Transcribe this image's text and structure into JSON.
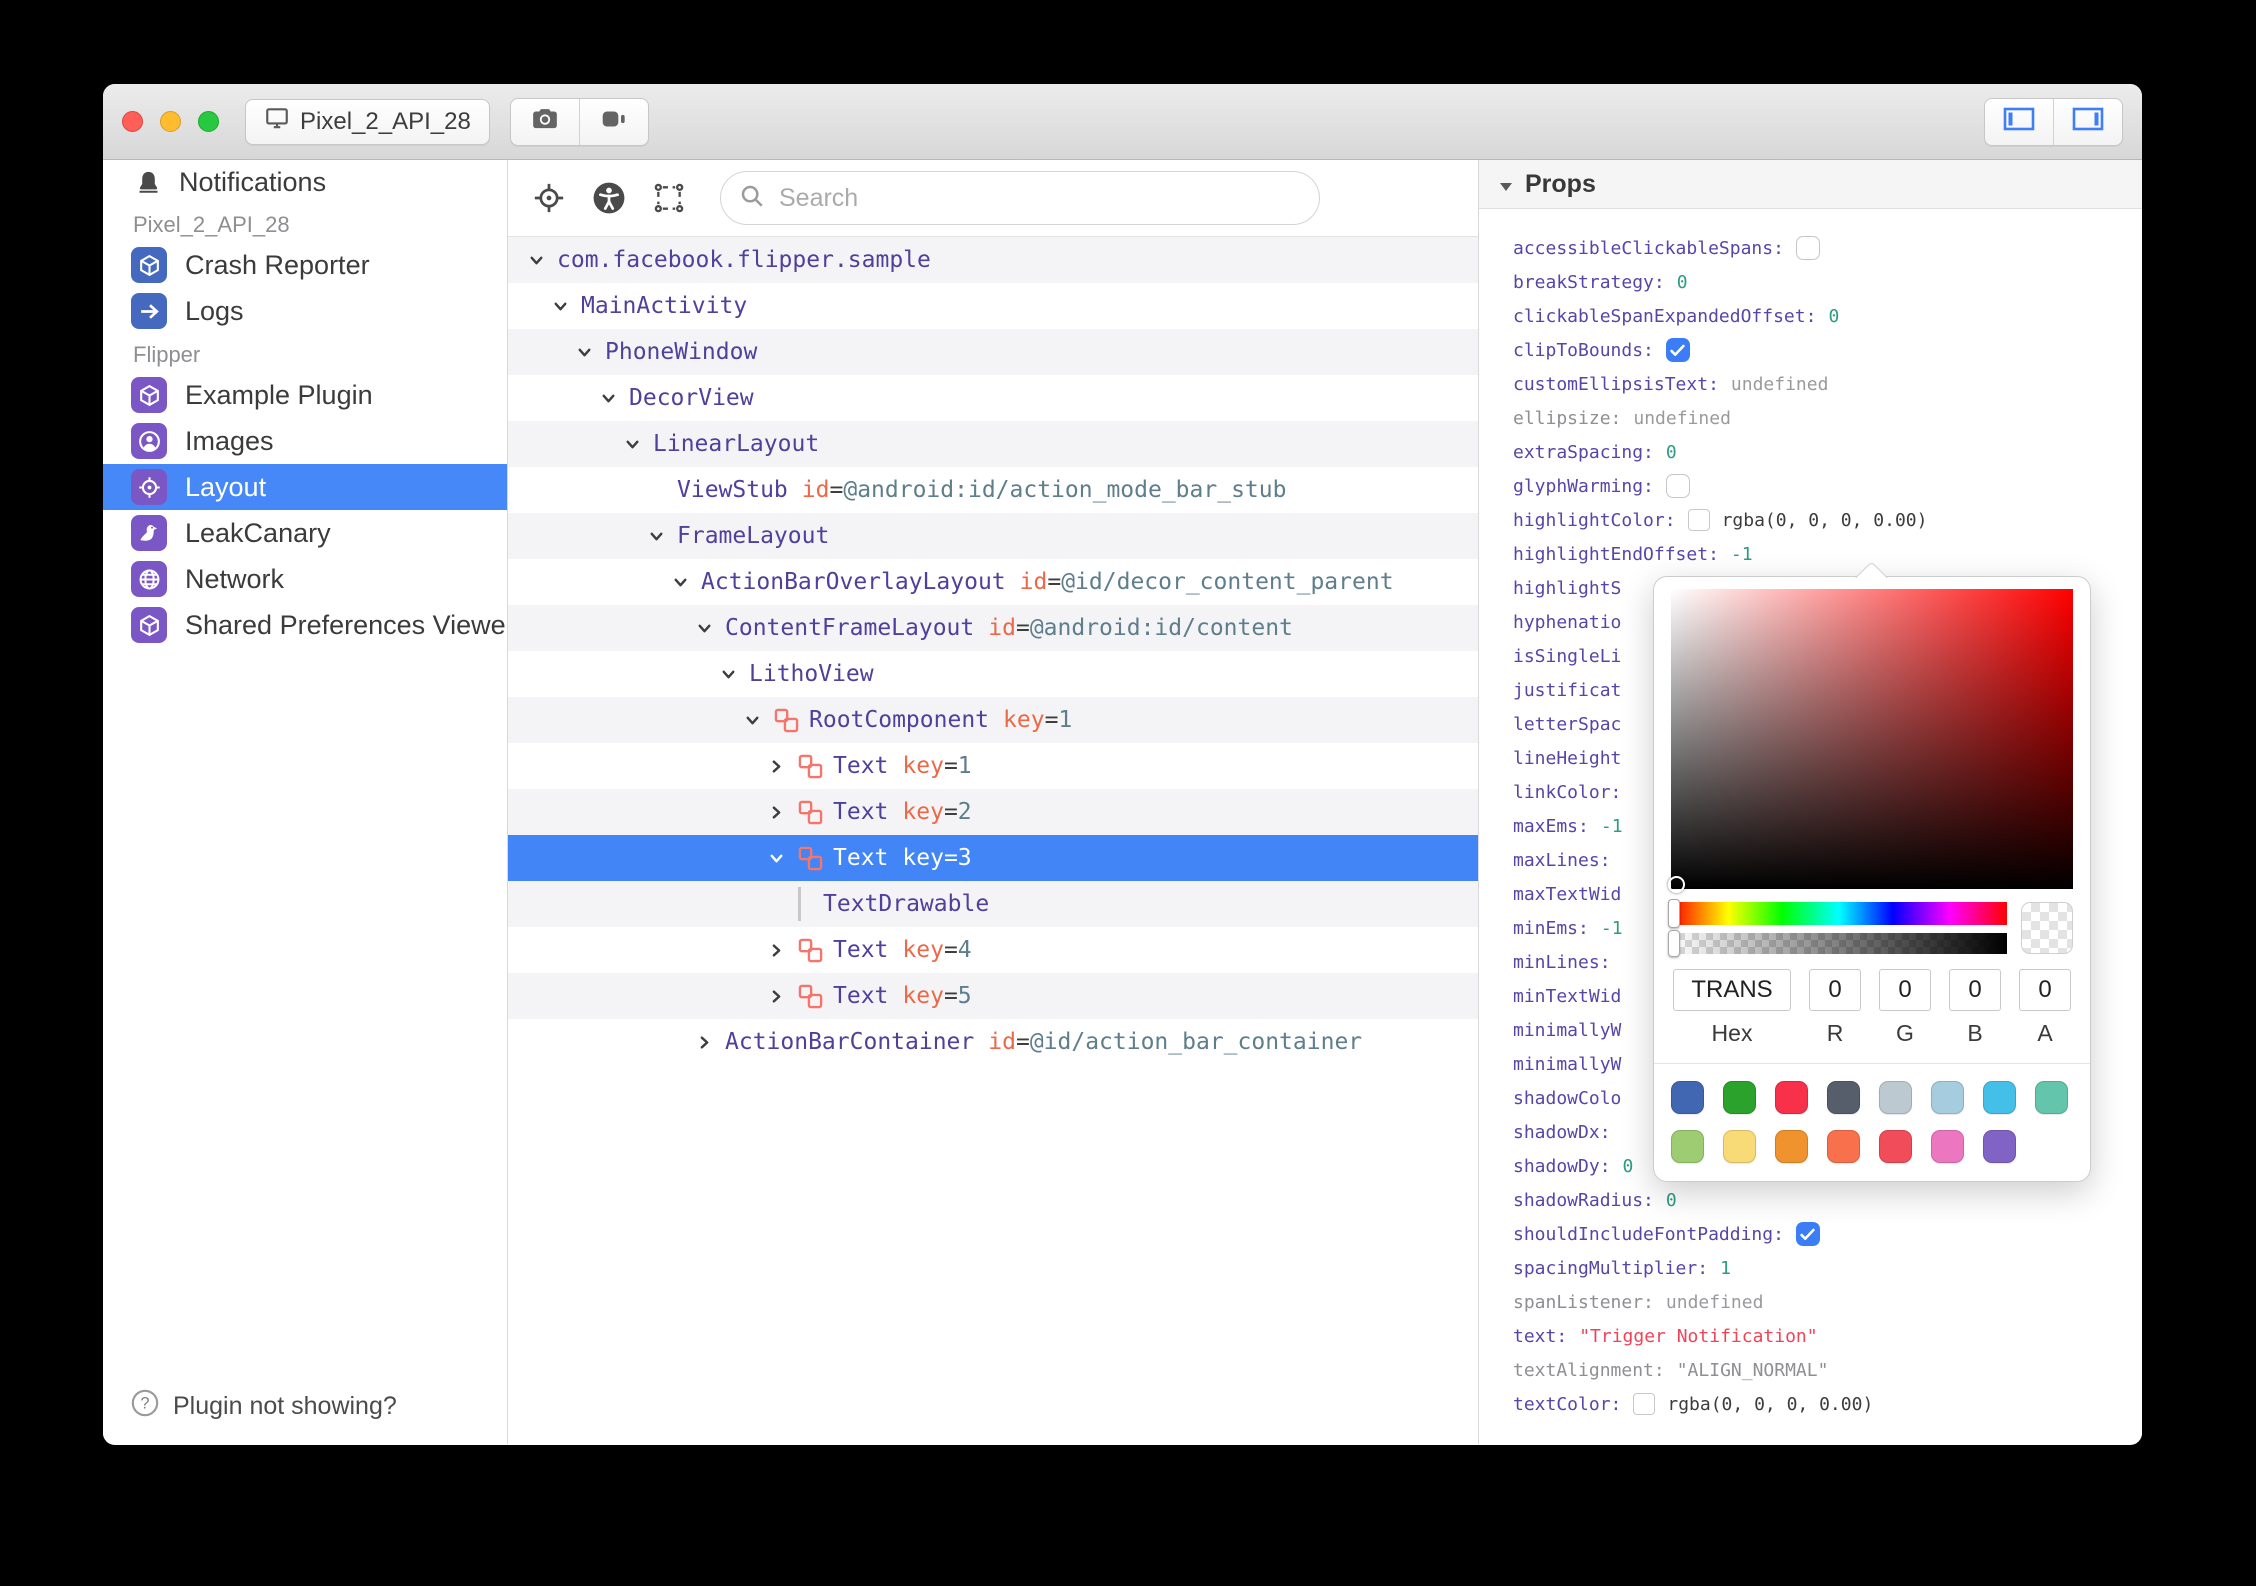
{
  "titlebar": {
    "device": "Pixel_2_API_28"
  },
  "sidebar": {
    "notifications_label": "Notifications",
    "sections": [
      {
        "label": "Pixel_2_API_28",
        "items": [
          {
            "label": "Crash Reporter",
            "icon": "cube-icon",
            "glyph": "cube",
            "color": "blue",
            "selected": false
          },
          {
            "label": "Logs",
            "icon": "arrow-right-icon",
            "glyph": "arrow",
            "color": "blue",
            "selected": false
          }
        ]
      },
      {
        "label": "Flipper",
        "items": [
          {
            "label": "Example Plugin",
            "icon": "cube-icon",
            "glyph": "cube",
            "color": "purple",
            "selected": false
          },
          {
            "label": "Images",
            "icon": "user-circle-icon",
            "glyph": "user",
            "color": "purple",
            "selected": false
          },
          {
            "label": "Layout",
            "icon": "target-icon",
            "glyph": "target",
            "color": "purple",
            "selected": true
          },
          {
            "label": "LeakCanary",
            "icon": "bird-icon",
            "glyph": "bird",
            "color": "purple",
            "selected": false
          },
          {
            "label": "Network",
            "icon": "globe-icon",
            "glyph": "globe",
            "color": "purple",
            "selected": false
          },
          {
            "label": "Shared Preferences Viewer",
            "icon": "cube-icon",
            "glyph": "cube",
            "color": "purple",
            "selected": false
          }
        ]
      }
    ],
    "footer": "Plugin not showing?"
  },
  "toolbar": {
    "search_placeholder": "Search"
  },
  "tree": {
    "rows": [
      {
        "name": "com.facebook.flipper.sample",
        "level": 0,
        "state": "expanded"
      },
      {
        "name": "MainActivity",
        "level": 1,
        "state": "expanded"
      },
      {
        "name": "PhoneWindow",
        "level": 2,
        "state": "expanded"
      },
      {
        "name": "DecorView",
        "level": 3,
        "state": "expanded"
      },
      {
        "name": "LinearLayout",
        "level": 4,
        "state": "expanded"
      },
      {
        "name": "ViewStub",
        "level": 5,
        "state": "leaf",
        "attr": "id",
        "value": "@android:id/action_mode_bar_stub"
      },
      {
        "name": "FrameLayout",
        "level": 5,
        "state": "expanded"
      },
      {
        "name": "ActionBarOverlayLayout",
        "level": 6,
        "state": "expanded",
        "attr": "id",
        "value": "@id/decor_content_parent"
      },
      {
        "name": "ContentFrameLayout",
        "level": 7,
        "state": "expanded",
        "attr": "id",
        "value": "@android:id/content"
      },
      {
        "name": "LithoView",
        "level": 8,
        "state": "expanded"
      },
      {
        "name": "RootComponent",
        "level": 9,
        "state": "expanded",
        "litho": true,
        "attr": "key",
        "value": "1"
      },
      {
        "name": "Text",
        "level": 10,
        "state": "collapsed",
        "litho": true,
        "attr": "key",
        "value": "1"
      },
      {
        "name": "Text",
        "level": 10,
        "state": "collapsed",
        "litho": true,
        "attr": "key",
        "value": "2"
      },
      {
        "name": "Text",
        "level": 10,
        "state": "expanded",
        "litho": true,
        "attr": "key",
        "value": "3",
        "selected": true
      },
      {
        "name": "TextDrawable",
        "level": 11,
        "state": "leaf",
        "bar": true
      },
      {
        "name": "Text",
        "level": 10,
        "state": "collapsed",
        "litho": true,
        "attr": "key",
        "value": "4"
      },
      {
        "name": "Text",
        "level": 10,
        "state": "collapsed",
        "litho": true,
        "attr": "key",
        "value": "5"
      },
      {
        "name": "ActionBarContainer",
        "level": 7,
        "state": "collapsed",
        "attr": "id",
        "value": "@id/action_bar_container"
      }
    ]
  },
  "props": {
    "header": "Props",
    "rows": [
      {
        "key": "accessibleClickableSpans",
        "colon": true,
        "val": {
          "t": "check",
          "on": false
        }
      },
      {
        "key": "breakStrategy",
        "colon": true,
        "val": {
          "t": "num",
          "v": "0"
        }
      },
      {
        "key": "clickableSpanExpandedOffset",
        "colon": true,
        "val": {
          "t": "num",
          "v": "0"
        }
      },
      {
        "key": "clipToBounds",
        "colon": true,
        "val": {
          "t": "check",
          "on": true
        }
      },
      {
        "key": "customEllipsisText",
        "colon": true,
        "val": {
          "t": "undef",
          "v": "undefined"
        }
      },
      {
        "key": "ellipsize",
        "gray": true,
        "colon": true,
        "val": {
          "t": "undef",
          "v": "undefined"
        }
      },
      {
        "key": "extraSpacing",
        "colon": true,
        "val": {
          "t": "num",
          "v": "0"
        }
      },
      {
        "key": "glyphWarming",
        "colon": true,
        "val": {
          "t": "check",
          "on": false
        }
      },
      {
        "key": "highlightColor",
        "colon": true,
        "val": {
          "t": "rgba",
          "v": "rgba(0, 0, 0, 0.00)"
        }
      },
      {
        "key": "highlightEndOffset",
        "colon": true,
        "val": {
          "t": "num",
          "v": "-1"
        }
      },
      {
        "key": "highlightS",
        "colon": false
      },
      {
        "key": "hyphenatio",
        "colon": false
      },
      {
        "key": "isSingleLi",
        "colon": false
      },
      {
        "key": "justificat",
        "colon": false
      },
      {
        "key": "letterSpac",
        "colon": false
      },
      {
        "key": "lineHeight",
        "colon": false
      },
      {
        "key": "linkColor",
        "colon": true
      },
      {
        "key": "maxEms",
        "colon": true,
        "val": {
          "t": "num",
          "v": "-1"
        }
      },
      {
        "key": "maxLines",
        "colon": true
      },
      {
        "key": "maxTextWid",
        "colon": false
      },
      {
        "key": "minEms",
        "colon": true,
        "val": {
          "t": "num",
          "v": "-1"
        }
      },
      {
        "key": "minLines",
        "colon": true
      },
      {
        "key": "minTextWid",
        "colon": false
      },
      {
        "key": "minimallyW",
        "colon": false
      },
      {
        "key": "minimallyW",
        "colon": false
      },
      {
        "key": "shadowColo",
        "colon": false
      },
      {
        "key": "shadowDx",
        "colon": true
      },
      {
        "key": "shadowDy",
        "colon": true,
        "val": {
          "t": "num",
          "v": "0"
        }
      },
      {
        "key": "shadowRadius",
        "colon": true,
        "val": {
          "t": "num",
          "v": "0"
        }
      },
      {
        "key": "shouldIncludeFontPadding",
        "colon": true,
        "val": {
          "t": "check",
          "on": true
        }
      },
      {
        "key": "spacingMultiplier",
        "colon": true,
        "val": {
          "t": "num",
          "v": "1"
        }
      },
      {
        "key": "spanListener",
        "gray": true,
        "colon": true,
        "val": {
          "t": "undef",
          "v": "undefined"
        }
      },
      {
        "key": "text",
        "colon": true,
        "val": {
          "t": "str",
          "v": "\"Trigger Notification\"",
          "gray": false
        }
      },
      {
        "key": "textAlignment",
        "gray": true,
        "colon": true,
        "val": {
          "t": "str",
          "v": "\"ALIGN_NORMAL\"",
          "gray": true
        }
      },
      {
        "key": "textColor",
        "colon": true,
        "val": {
          "t": "rgba",
          "v": "rgba(0, 0, 0, 0.00)"
        }
      }
    ]
  },
  "picker": {
    "hex_value": "TRANS",
    "r_value": "0",
    "g_value": "0",
    "b_value": "0",
    "a_value": "0",
    "labels": {
      "hex": "Hex",
      "r": "R",
      "g": "G",
      "b": "B",
      "a": "A"
    },
    "swatch_rows": [
      [
        "#4267B2",
        "#2BA22B",
        "#F8304A",
        "#575E6B",
        "#BCC9D1",
        "#A5CCDF",
        "#43BFE8",
        "#62C5AC"
      ],
      [
        "#9DCC72",
        "#F8DA77",
        "#F0922E",
        "#F9704D",
        "#F04C59",
        "#EC77C0",
        "#8163C5"
      ]
    ]
  }
}
